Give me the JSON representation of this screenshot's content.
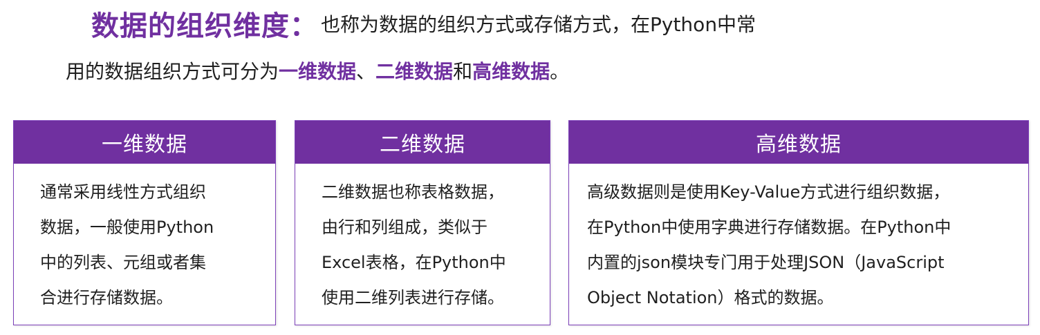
{
  "intro": {
    "heading": "数据的组织维度：",
    "line1": "也称为数据的组织方式或存储方式，在Python中常",
    "line2_prefix": "用的数据组织方式可分为",
    "term1": "一维数据",
    "sep1": "、",
    "term2": "二维数据",
    "sep2": "和",
    "term3": "高维数据",
    "end": "。"
  },
  "cards": [
    {
      "title": "一维数据",
      "lines": [
        "通常采用线性方式组织",
        "数据，一般使用Python",
        "中的列表、元组或者集",
        "合进行存储数据。"
      ]
    },
    {
      "title": "二维数据",
      "lines": [
        "二维数据也称表格数据，",
        "由行和列组成，类似于",
        "Excel表格，在Python中",
        "使用二维列表进行存储。"
      ]
    },
    {
      "title": "高维数据",
      "lines": [
        "高级数据则是使用Key-Value方式进行组织数据，",
        "在Python中使用字典进行存储数据。在Python中",
        "内置的json模块专门用于处理JSON（JavaScript",
        "Object Notation）格式的数据。"
      ]
    }
  ],
  "colors": {
    "accent": "#7030a0",
    "text": "#1f1f1f",
    "background": "#ffffff"
  }
}
